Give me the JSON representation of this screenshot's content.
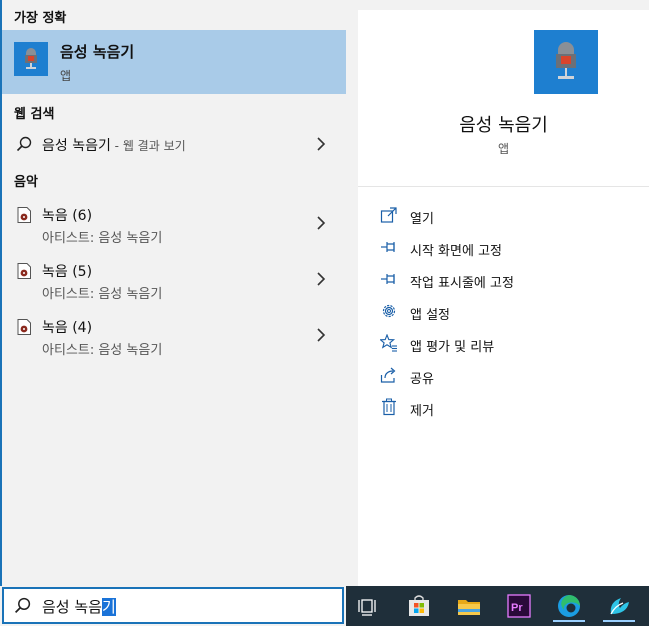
{
  "left": {
    "best_match_header": "가장 정확",
    "best_match": {
      "title": "음성 녹음기",
      "subtitle": "앱"
    },
    "web_header": "웹 검색",
    "web_result": {
      "query": "음성 녹음기",
      "suffix": " - 웹 결과 보기"
    },
    "music_header": "음악",
    "music_items": [
      {
        "title": "녹음 (6)",
        "artist": "아티스트: 음성 녹음기"
      },
      {
        "title": "녹음 (5)",
        "artist": "아티스트: 음성 녹음기"
      },
      {
        "title": "녹음 (4)",
        "artist": "아티스트: 음성 녹음기"
      }
    ]
  },
  "right": {
    "app_name": "음성 녹음기",
    "app_type": "앱",
    "actions": [
      {
        "label": "열기",
        "icon": "open-icon"
      },
      {
        "label": "시작 화면에 고정",
        "icon": "pin-icon"
      },
      {
        "label": "작업 표시줄에 고정",
        "icon": "pin-icon"
      },
      {
        "label": "앱 설정",
        "icon": "gear-icon"
      },
      {
        "label": "앱 평가 및 리뷰",
        "icon": "star-icon"
      },
      {
        "label": "공유",
        "icon": "share-icon"
      },
      {
        "label": "제거",
        "icon": "trash-icon"
      }
    ]
  },
  "search": {
    "typed": "음성 녹음",
    "selected": "기"
  },
  "taskbar": {
    "items": [
      "task-view-icon",
      "store-icon",
      "file-explorer-icon",
      "premiere-icon",
      "edge-icon",
      "app-icon"
    ]
  },
  "colors": {
    "accent": "#1a73b8",
    "highlight": "#a9cbe8",
    "tile": "#1e7fd0",
    "taskbar": "#1f2f3a"
  }
}
